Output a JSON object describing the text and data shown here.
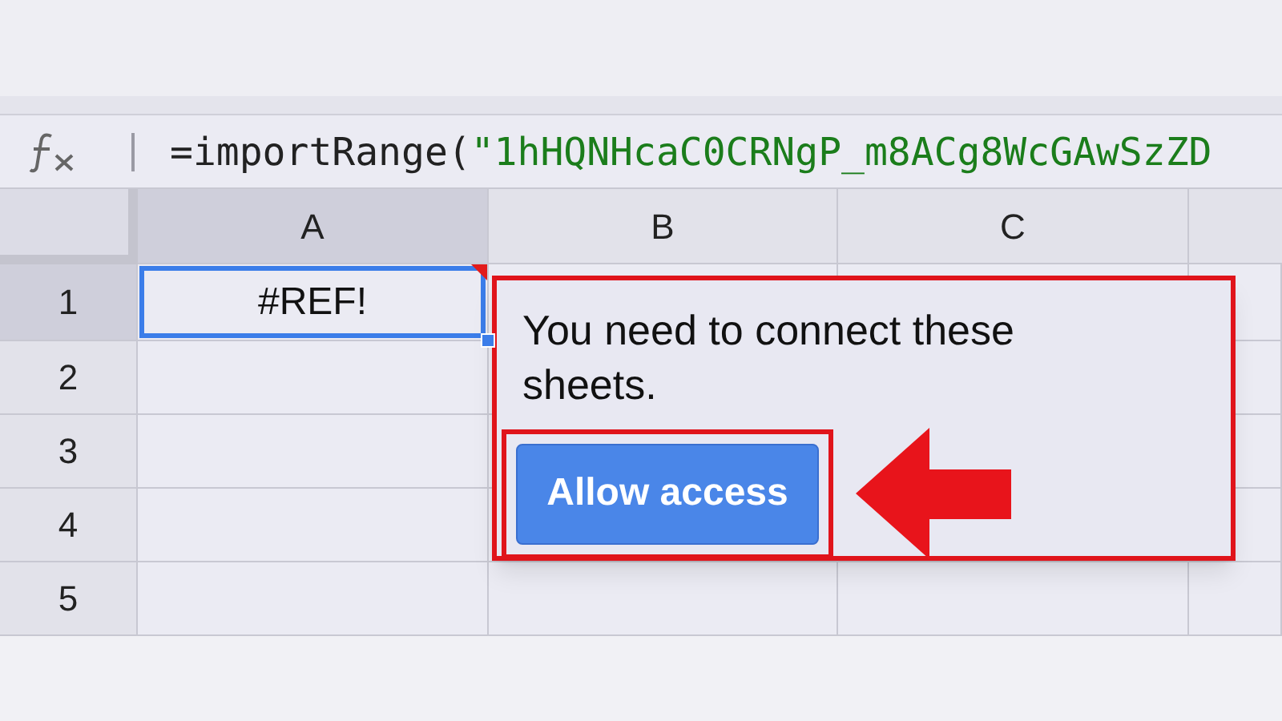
{
  "formula_bar": {
    "function_text": "=importRange(",
    "argument_text": "\"1hHQNHcaC0CRNgP_m8ACg8WcGAwSzZD"
  },
  "columns": [
    {
      "label": "A",
      "selected": true
    },
    {
      "label": "B",
      "selected": false
    },
    {
      "label": "C",
      "selected": false
    }
  ],
  "rows": [
    {
      "label": "1",
      "selected": true,
      "cell": {
        "value": "#REF!",
        "selected": true,
        "has_comment": true
      }
    },
    {
      "label": "2",
      "selected": false
    },
    {
      "label": "3",
      "selected": false
    },
    {
      "label": "4",
      "selected": false
    },
    {
      "label": "5",
      "selected": false
    }
  ],
  "popup": {
    "message": "You need to connect these sheets.",
    "button": "Allow access",
    "highlighted": true
  }
}
